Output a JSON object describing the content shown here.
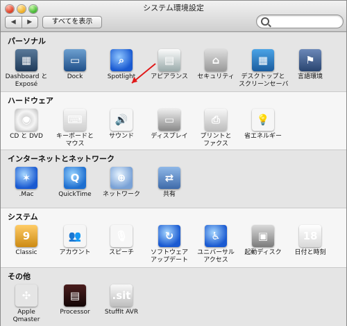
{
  "window": {
    "title": "システム環境設定",
    "show_all_label": "すべてを表示",
    "search_placeholder": ""
  },
  "sections": [
    {
      "title": "パーソナル",
      "items": [
        {
          "label": "Dashboard と",
          "label2": "Exposé",
          "icon": "dashboard-icon",
          "glyph": "◼"
        },
        {
          "label": "Dock",
          "icon": "dock-icon",
          "glyph": "▭"
        },
        {
          "label": "Spotlight",
          "icon": "spotlight-icon",
          "glyph": "⌕"
        },
        {
          "label": "アピアランス",
          "icon": "appearance-icon",
          "glyph": "▤"
        },
        {
          "label": "セキュリティ",
          "icon": "security-icon",
          "glyph": "⌂"
        },
        {
          "label": "デスクトップと",
          "label2": "スクリーンセーバ",
          "icon": "desktop-screensaver-icon",
          "glyph": "▦"
        },
        {
          "label": "言語環境",
          "icon": "international-icon",
          "glyph": "⚑"
        }
      ]
    },
    {
      "title": "ハードウェア",
      "items": [
        {
          "label": "CD と DVD",
          "icon": "cd-dvd-icon",
          "glyph": "◎"
        },
        {
          "label": "キーボードと",
          "label2": "マウス",
          "icon": "keyboard-mouse-icon",
          "glyph": "⌨"
        },
        {
          "label": "サウンド",
          "icon": "sound-icon",
          "glyph": "🔊"
        },
        {
          "label": "ディスプレイ",
          "icon": "displays-icon",
          "glyph": "▭"
        },
        {
          "label": "プリントと",
          "label2": "ファクス",
          "icon": "print-fax-icon",
          "glyph": "⎙"
        },
        {
          "label": "省エネルギー",
          "icon": "energy-saver-icon",
          "glyph": "💡"
        }
      ]
    },
    {
      "title": "インターネットとネットワーク",
      "items": [
        {
          "label": ".Mac",
          "icon": "dotmac-icon",
          "glyph": "✶"
        },
        {
          "label": "QuickTime",
          "icon": "quicktime-icon",
          "glyph": "Q"
        },
        {
          "label": "ネットワーク",
          "icon": "network-icon",
          "glyph": "⊕"
        },
        {
          "label": "共有",
          "icon": "sharing-icon",
          "glyph": "⇄"
        }
      ]
    },
    {
      "title": "システム",
      "items": [
        {
          "label": "Classic",
          "icon": "classic-icon",
          "glyph": "9"
        },
        {
          "label": "アカウント",
          "icon": "accounts-icon",
          "glyph": "👥"
        },
        {
          "label": "スピーチ",
          "icon": "speech-icon",
          "glyph": "🎙"
        },
        {
          "label": "ソフトウェア",
          "label2": "アップデート",
          "icon": "software-update-icon",
          "glyph": "↻"
        },
        {
          "label": "ユニバーサル",
          "label2": "アクセス",
          "icon": "universal-access-icon",
          "glyph": "♿"
        },
        {
          "label": "起動ディスク",
          "icon": "startup-disk-icon",
          "glyph": "▣"
        },
        {
          "label": "日付と時刻",
          "icon": "date-time-icon",
          "glyph": "18"
        }
      ]
    },
    {
      "title": "その他",
      "items": [
        {
          "label": "Apple",
          "label2": "Qmaster",
          "icon": "apple-qmaster-icon",
          "glyph": "✣"
        },
        {
          "label": "Processor",
          "icon": "processor-icon",
          "glyph": "▤"
        },
        {
          "label": "StuffIt AVR",
          "icon": "stuffit-avr-icon",
          "glyph": ".sit"
        }
      ]
    }
  ]
}
